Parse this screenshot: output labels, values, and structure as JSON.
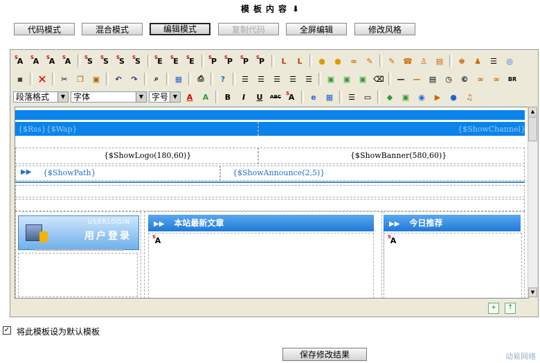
{
  "header": {
    "title": "模板内容",
    "arrow": "⬇"
  },
  "modes": [
    {
      "label": "代码模式",
      "state": "normal"
    },
    {
      "label": "混合模式",
      "state": "normal"
    },
    {
      "label": "编辑模式",
      "state": "active"
    },
    {
      "label": "复制代码",
      "state": "disabled"
    },
    {
      "label": "全屏编辑",
      "state": "normal"
    },
    {
      "label": "修改风格",
      "state": "normal"
    }
  ],
  "toolbar": {
    "paragraph_select": "段落格式",
    "font_select": "字体",
    "size_select": "字号"
  },
  "canvas": {
    "rss_wap": "{$Rss}{$Wap}",
    "show_channel": "{$ShowChannel}",
    "show_logo": "{$ShowLogo(180,60)}",
    "show_banner": "{$ShowBanner(580,60)}",
    "show_path": "{$ShowPath}",
    "show_announce": "{$ShowAnnounce(2,5)}",
    "login_en": "USERLOGIN",
    "login_cn": "用户登录",
    "latest_title": "本站最新文章",
    "recommend_title": "今日推荐"
  },
  "options": {
    "default_template_label": "将此模板设为默认模板",
    "default_template_checked": true
  },
  "footer": {
    "save_label": "保存修改结果",
    "watermark": "动易网络"
  }
}
